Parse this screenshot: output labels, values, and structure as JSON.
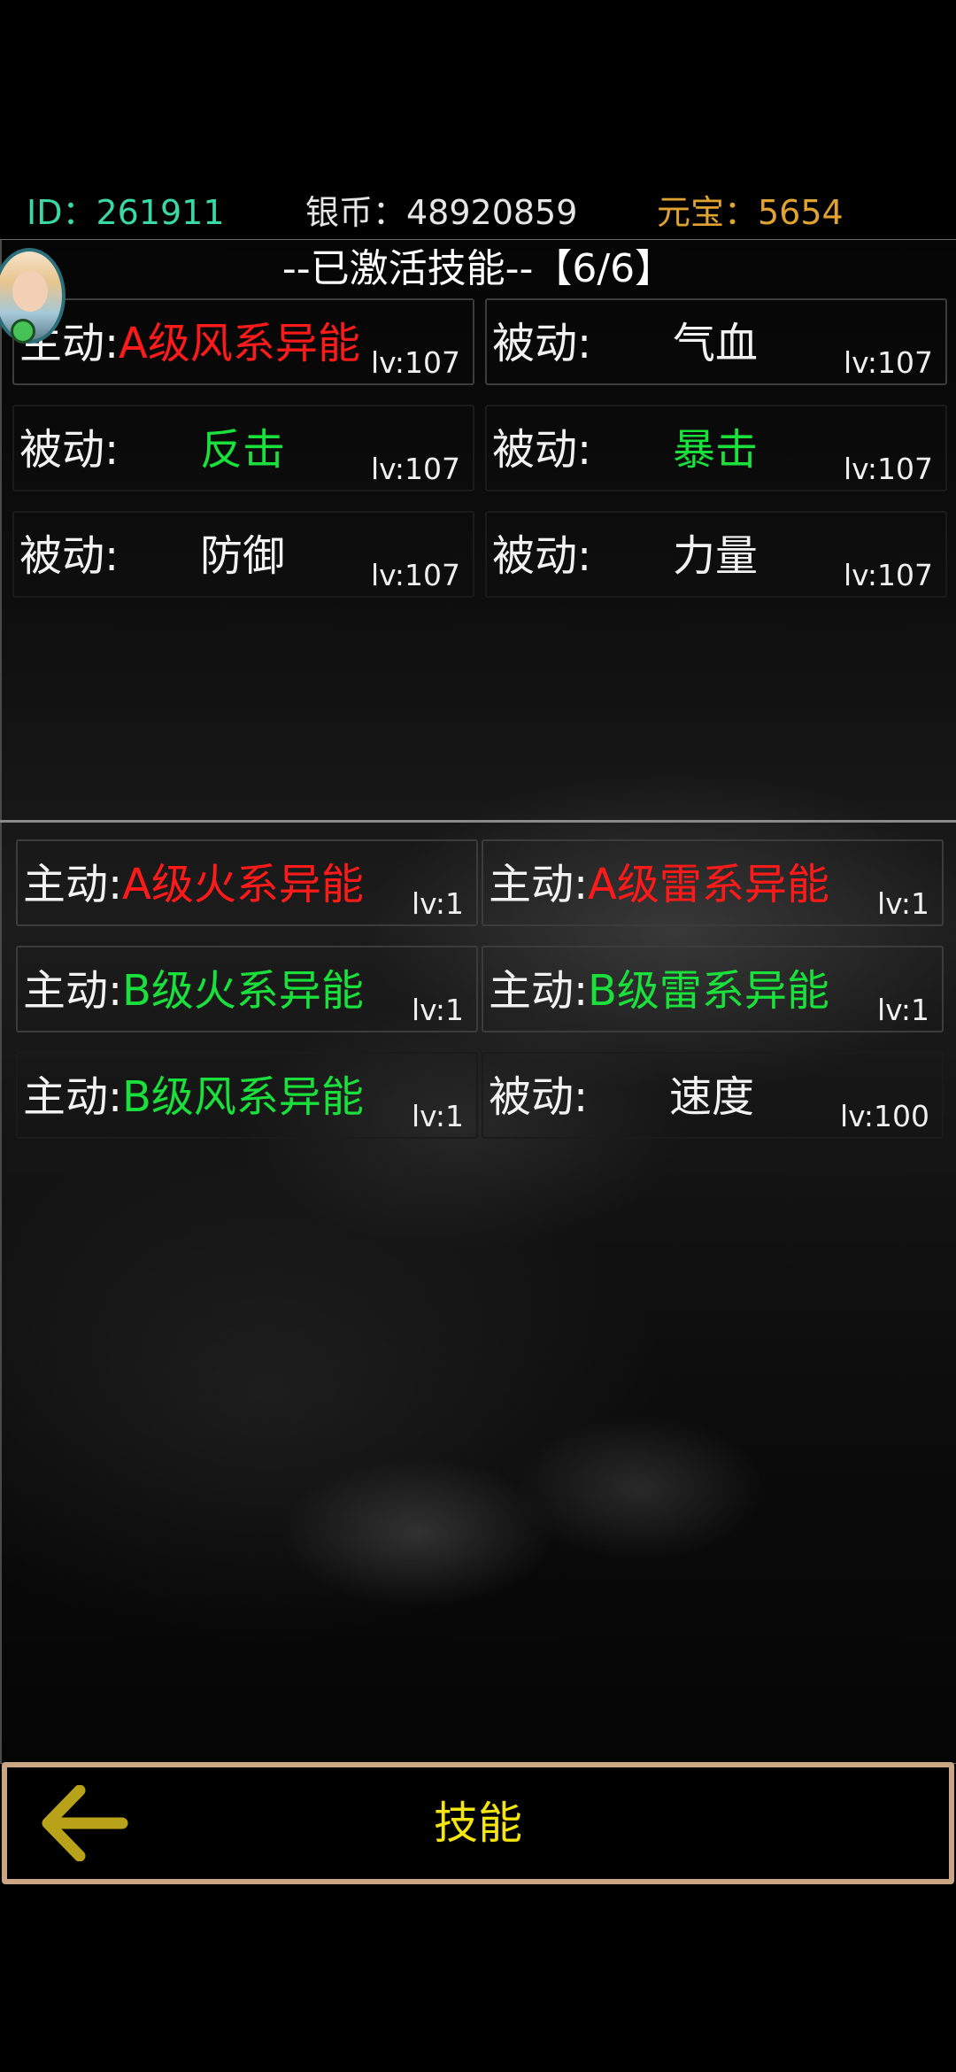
{
  "stats": {
    "id": "ID：261911",
    "silver": "银币：48920859",
    "gold": "元宝：5654"
  },
  "activated": {
    "title": "--已激活技能--【6/6】",
    "skills": [
      {
        "type": "主动:",
        "name": "A级风系异能",
        "level": "lv:107"
      },
      {
        "type": "被动:",
        "name": "气血",
        "level": "lv:107"
      },
      {
        "type": "被动:",
        "name": "反击",
        "level": "lv:107"
      },
      {
        "type": "被动:",
        "name": "暴击",
        "level": "lv:107"
      },
      {
        "type": "被动:",
        "name": "防御",
        "level": "lv:107"
      },
      {
        "type": "被动:",
        "name": "力量",
        "level": "lv:107"
      }
    ]
  },
  "available": {
    "skills": [
      {
        "type": "主动:",
        "name": "A级火系异能",
        "level": "lv:1"
      },
      {
        "type": "主动:",
        "name": "A级雷系异能",
        "level": "lv:1"
      },
      {
        "type": "主动:",
        "name": "B级火系异能",
        "level": "lv:1"
      },
      {
        "type": "主动:",
        "name": "B级雷系异能",
        "level": "lv:1"
      },
      {
        "type": "主动:",
        "name": "B级风系异能",
        "level": "lv:1"
      },
      {
        "type": "被动:",
        "name": "速度",
        "level": "lv:100"
      }
    ]
  },
  "footer": {
    "title": "技能",
    "back_icon": "arrow-left-icon"
  },
  "colors": {
    "id": "#39d8a6",
    "gold": "#e0a332",
    "a_grade": "#ff1a1a",
    "b_grade": "#19e03b",
    "footer_title": "#f4e410",
    "footer_border": "#caa685",
    "back_arrow": "#b8a21a"
  }
}
